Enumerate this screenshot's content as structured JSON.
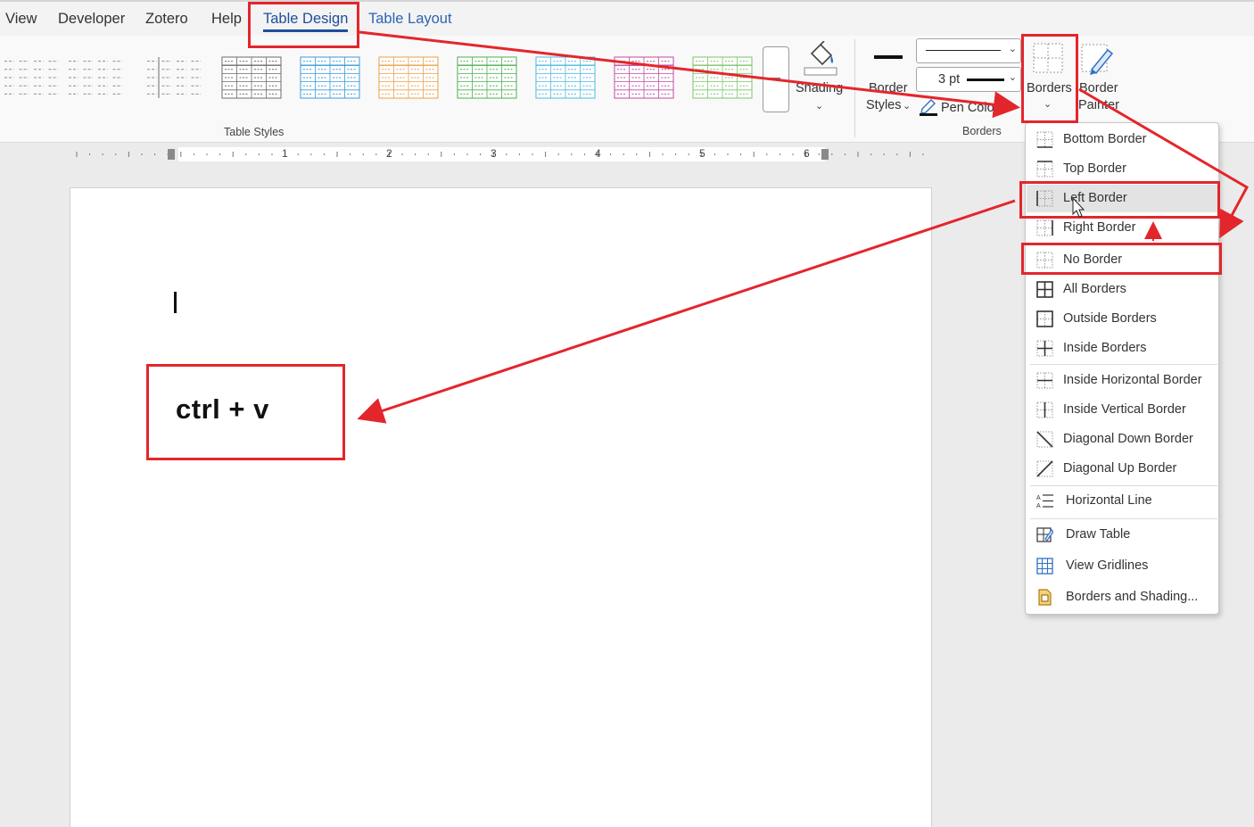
{
  "tabs": [
    {
      "label": "View"
    },
    {
      "label": "Developer"
    },
    {
      "label": "Zotero"
    },
    {
      "label": "Help"
    },
    {
      "label": "Table Design"
    },
    {
      "label": "Table Layout"
    }
  ],
  "ribbon": {
    "table_styles_label": "Table Styles",
    "shading_label": "Shading",
    "border_styles_line1": "Border",
    "border_styles_line2": "Styles",
    "pen_weight": "3 pt",
    "pen_color_label": "Pen Color",
    "borders_group_label": "Borders",
    "borders_button_label": "Borders",
    "border_painter_line1": "Border",
    "border_painter_line2": "Painter",
    "style_colors": [
      "#8c8c8c",
      "#8c8c8c",
      "#8c8c8c",
      "#6b6b6b",
      "#3a9ad9",
      "#e8a04a",
      "#4caf50",
      "#4fb7e0",
      "#c04aa0",
      "#7cc36a"
    ]
  },
  "ruler": {
    "numbers": [
      "1",
      "2",
      "3",
      "4",
      "5",
      "6"
    ]
  },
  "document": {
    "callout_text": "ctrl + v"
  },
  "borders_menu": {
    "items": [
      {
        "label": "Bottom Border",
        "icon": "bottom-border-icon"
      },
      {
        "label": "Top Border",
        "icon": "top-border-icon"
      },
      {
        "label": "Left Border",
        "icon": "left-border-icon"
      },
      {
        "label": "Right Border",
        "icon": "right-border-icon"
      },
      {
        "label": "No Border",
        "icon": "no-border-icon"
      },
      {
        "label": "All Borders",
        "icon": "all-borders-icon"
      },
      {
        "label": "Outside Borders",
        "icon": "outside-borders-icon"
      },
      {
        "label": "Inside Borders",
        "icon": "inside-borders-icon"
      },
      {
        "label": "Inside Horizontal Border",
        "icon": "inside-horizontal-border-icon"
      },
      {
        "label": "Inside Vertical Border",
        "icon": "inside-vertical-border-icon"
      },
      {
        "label": "Diagonal Down Border",
        "icon": "diagonal-down-border-icon"
      },
      {
        "label": "Diagonal Up Border",
        "icon": "diagonal-up-border-icon"
      },
      {
        "label": "Horizontal Line",
        "icon": "horizontal-line-icon"
      },
      {
        "label": "Draw Table",
        "icon": "draw-table-icon"
      },
      {
        "label": "View Gridlines",
        "icon": "view-gridlines-icon"
      },
      {
        "label": "Borders and Shading...",
        "icon": "borders-and-shading-icon"
      }
    ]
  },
  "colors": {
    "annotation_red": "#e3262b",
    "accent_blue": "#1f4e9c"
  }
}
